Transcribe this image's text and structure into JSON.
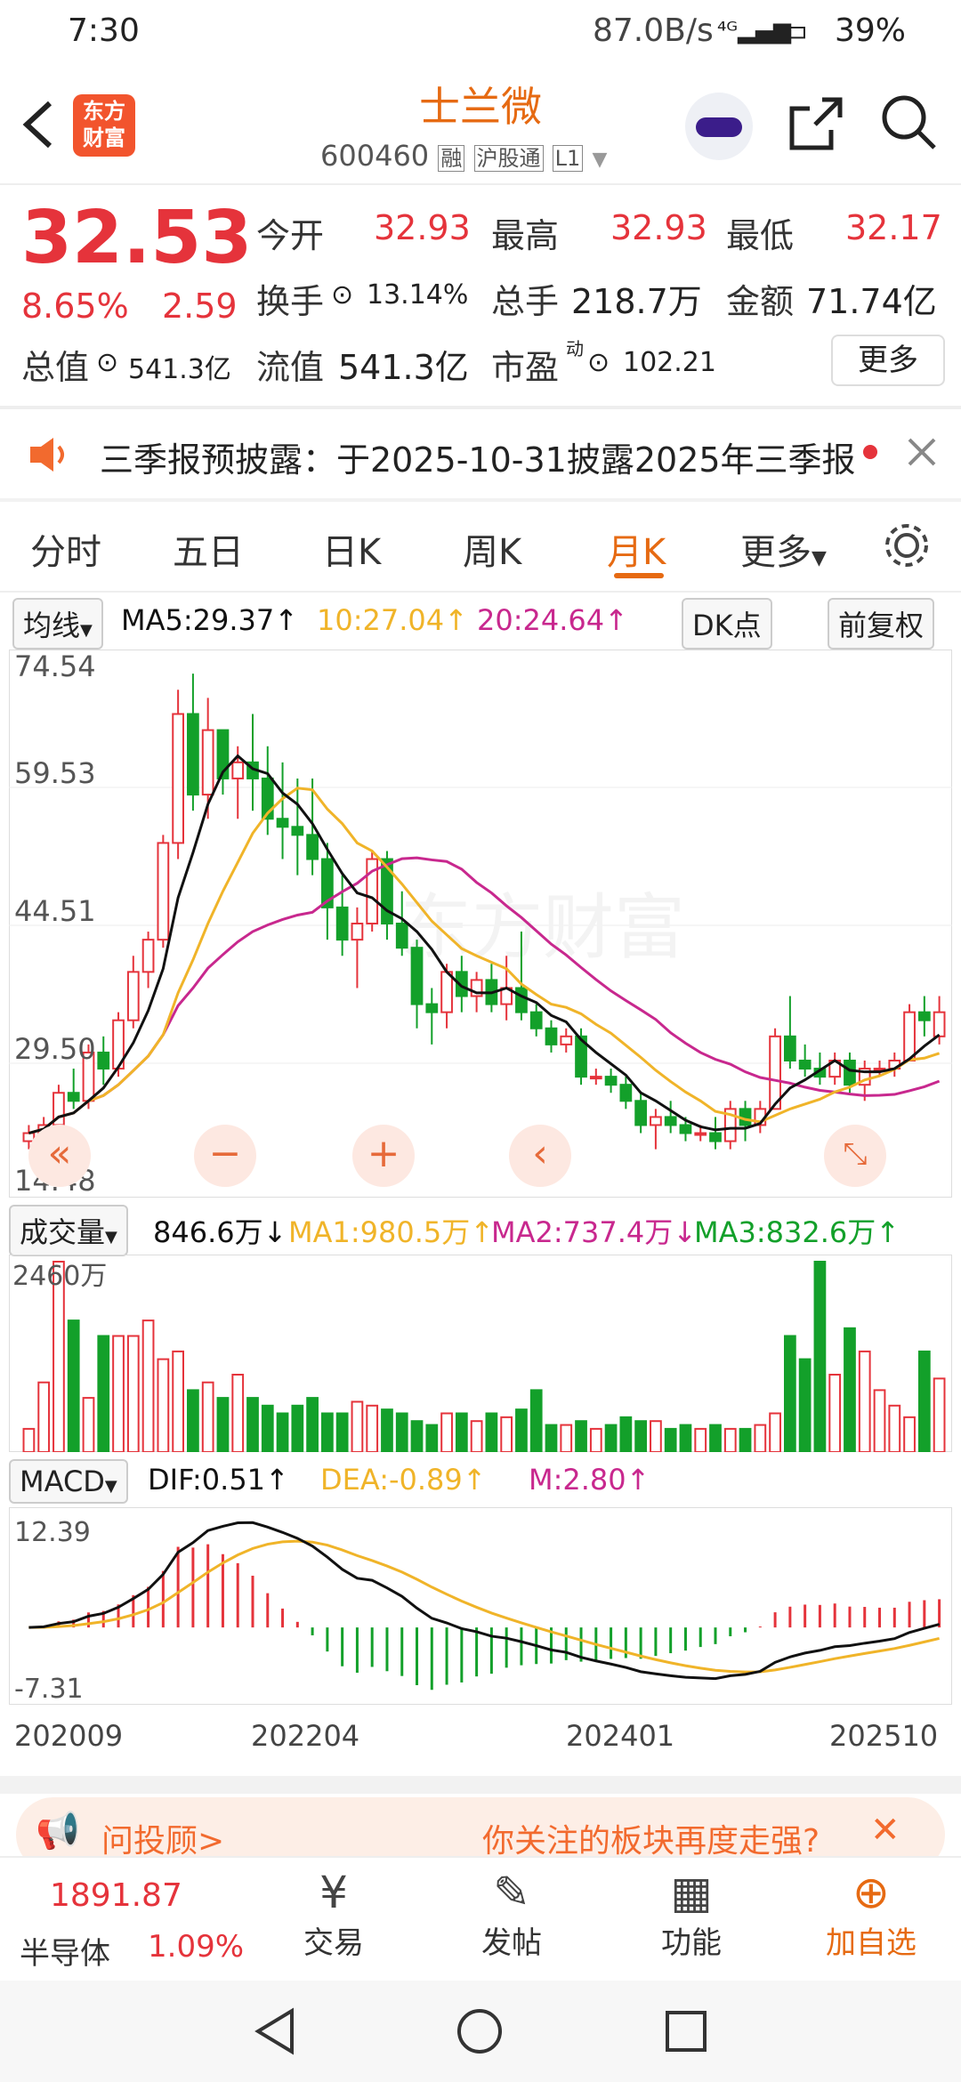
{
  "status": {
    "time": "7:30",
    "net_speed": "87.0B/s",
    "battery": "39%"
  },
  "header": {
    "title": "士兰微",
    "code": "600460",
    "tag1": "融",
    "tag2": "沪股通",
    "tag3": "L1",
    "logo_line1": "东方",
    "logo_line2": "财富"
  },
  "quote": {
    "price": "32.53",
    "change_pct": "8.65%",
    "change": "2.59",
    "open_label": "今开",
    "open": "32.93",
    "high_label": "最高",
    "high": "32.93",
    "low_label": "最低",
    "low": "32.17",
    "turnover_label": "换手",
    "turnover": "13.14%",
    "volume_label": "总手",
    "volume": "218.7万",
    "amount_label": "金额",
    "amount": "71.74亿",
    "mktcap_label": "总值",
    "mktcap": "541.3亿",
    "float_label": "流值",
    "float": "541.3亿",
    "pe_label": "市盈",
    "pe_sup": "动",
    "pe": "102.21",
    "more_label": "更多"
  },
  "notice": {
    "text": "三季报预披露：于2025-10-31披露2025年三季报"
  },
  "tabs": [
    "分时",
    "五日",
    "日K",
    "周K",
    "月K",
    "更多"
  ],
  "active_tab": "月K",
  "ma_bar": {
    "selector": "均线",
    "ma5": "MA5:29.37↑",
    "ma10": "10:27.04↑",
    "ma20": "20:24.64↑",
    "dk": "DK点",
    "fq": "前复权"
  },
  "kchart": {
    "y_labels": [
      "74.54",
      "59.53",
      "44.51",
      "29.50",
      "14.48"
    ],
    "watermark": "东方财富"
  },
  "vol_bar": {
    "selector": "成交量",
    "vol": "846.6万↓",
    "ma1": "MA1:980.5万↑",
    "ma2": "MA2:737.4万↓",
    "ma3": "MA3:832.6万↑",
    "top": "2460万"
  },
  "macd_bar": {
    "selector": "MACD",
    "dif": "DIF:0.51↑",
    "dea": "DEA:-0.89↑",
    "m": "M:2.80↑",
    "top": "12.39",
    "bottom": "-7.31"
  },
  "x_labels": [
    "202009",
    "202204",
    "202401",
    "202510"
  ],
  "banner": {
    "left": "问投顾>",
    "right": "你关注的板块再度走强?"
  },
  "bottom": {
    "index_value": "1891.87",
    "index_name": "半导体",
    "index_pct": "1.09%",
    "trade": "交易",
    "post": "发帖",
    "func": "功能",
    "add": "加自选"
  },
  "colors": {
    "up": "#e5333b",
    "down": "#13a02a",
    "ma5": "#111111",
    "ma10": "#f0b429",
    "ma20": "#c8288e",
    "accent": "#e66a12"
  },
  "chart_data": {
    "type": "candlestick",
    "period": "monthly",
    "ylim": [
      14.48,
      74.54
    ],
    "ohlc": [
      [
        17,
        19,
        16,
        18
      ],
      [
        18,
        20,
        17,
        19
      ],
      [
        19,
        24,
        18,
        23
      ],
      [
        23,
        26,
        21,
        22
      ],
      [
        22,
        29,
        21,
        28
      ],
      [
        28,
        30,
        24,
        26
      ],
      [
        26,
        33,
        25,
        32
      ],
      [
        32,
        40,
        31,
        38
      ],
      [
        38,
        43,
        36,
        42
      ],
      [
        42,
        55,
        41,
        54
      ],
      [
        54,
        73,
        52,
        70
      ],
      [
        70,
        75,
        58,
        60
      ],
      [
        60,
        72,
        57,
        68
      ],
      [
        68,
        66,
        60,
        62
      ],
      [
        62,
        66,
        57,
        64
      ],
      [
        64,
        70,
        58,
        62
      ],
      [
        62,
        66,
        55,
        57
      ],
      [
        57,
        64,
        52,
        56
      ],
      [
        56,
        62,
        50,
        55
      ],
      [
        55,
        62,
        50,
        52
      ],
      [
        52,
        54,
        42,
        46
      ],
      [
        46,
        50,
        40,
        42
      ],
      [
        42,
        46,
        36,
        44
      ],
      [
        44,
        53,
        43,
        52
      ],
      [
        52,
        53,
        42,
        44
      ],
      [
        44,
        48,
        40,
        41
      ],
      [
        41,
        42,
        31,
        34
      ],
      [
        34,
        36,
        29,
        33
      ],
      [
        33,
        39,
        31,
        38
      ],
      [
        38,
        40,
        33,
        35
      ],
      [
        35,
        38,
        33,
        37
      ],
      [
        37,
        39,
        33,
        34
      ],
      [
        34,
        40,
        32,
        36
      ],
      [
        36,
        43,
        32,
        33
      ],
      [
        33,
        34,
        30,
        31
      ],
      [
        31,
        32,
        28,
        29
      ],
      [
        29,
        31,
        28,
        30
      ],
      [
        30,
        31,
        24,
        25
      ],
      [
        25,
        26,
        24,
        25
      ],
      [
        25,
        26,
        23,
        24
      ],
      [
        24,
        25,
        21,
        22
      ],
      [
        22,
        23,
        18,
        19
      ],
      [
        19,
        21,
        16,
        20
      ],
      [
        20,
        22,
        18,
        19
      ],
      [
        19,
        20,
        17,
        18
      ],
      [
        18,
        19,
        17,
        18
      ],
      [
        18,
        20,
        16,
        17
      ],
      [
        17,
        22,
        16,
        21
      ],
      [
        21,
        22,
        17,
        19
      ],
      [
        19,
        22,
        18,
        21
      ],
      [
        21,
        31,
        21,
        30
      ],
      [
        30,
        35,
        26,
        27
      ],
      [
        27,
        29,
        25,
        26
      ],
      [
        26,
        28,
        24,
        25
      ],
      [
        25,
        28,
        24,
        27
      ],
      [
        27,
        28,
        23,
        24
      ],
      [
        24,
        27,
        22,
        26
      ],
      [
        26,
        27,
        25,
        26
      ],
      [
        26,
        28,
        25,
        27
      ],
      [
        27,
        34,
        27,
        33
      ],
      [
        33,
        35,
        30,
        32
      ],
      [
        30,
        35,
        29,
        33
      ]
    ],
    "volume": [
      300,
      900,
      2460,
      1700,
      700,
      1500,
      1500,
      1500,
      1700,
      1200,
      1300,
      800,
      900,
      700,
      1000,
      700,
      600,
      500,
      600,
      700,
      500,
      500,
      650,
      600,
      550,
      500,
      400,
      350,
      500,
      500,
      400,
      500,
      450,
      550,
      800,
      350,
      350,
      400,
      300,
      350,
      450,
      400,
      400,
      300,
      350,
      300,
      350,
      300,
      300,
      350,
      500,
      1500,
      1200,
      2460,
      1000,
      1600,
      1300,
      800,
      600,
      450,
      1300,
      950,
      1100
    ],
    "macd": {
      "range": [
        -7.31,
        12.39
      ]
    }
  }
}
